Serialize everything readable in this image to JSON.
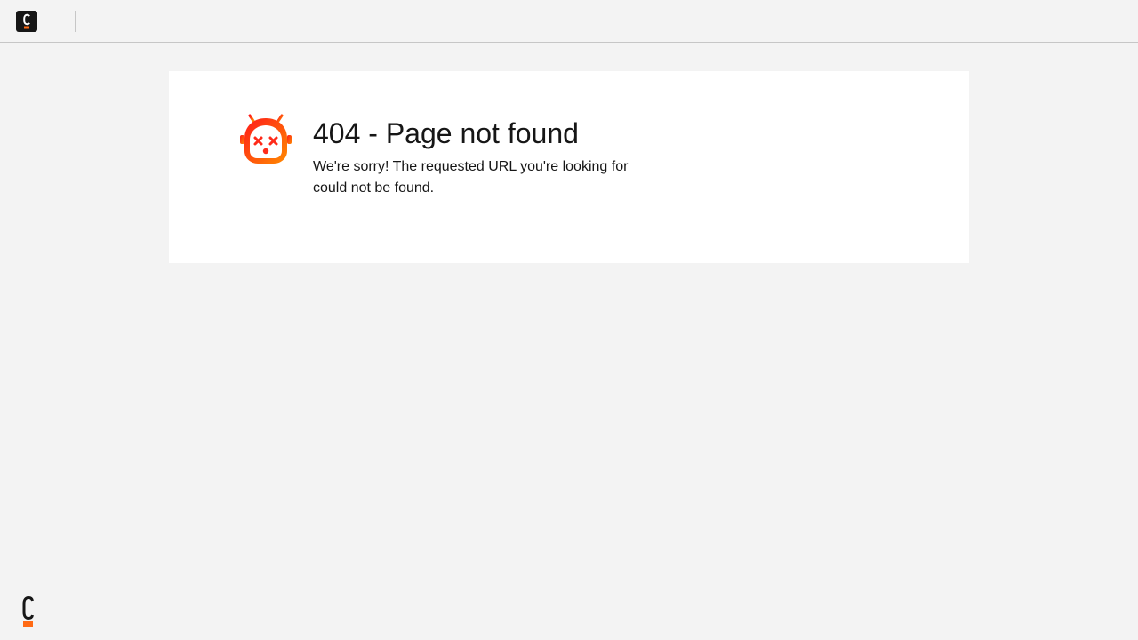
{
  "header": {
    "logo_icon": "brand-c-logo-icon"
  },
  "error": {
    "icon": "broken-robot-icon",
    "title": "404 - Page not found",
    "message": "We're sorry! The requested URL you're looking for could not be found."
  },
  "footer": {
    "logo_icon": "brand-c-logo-icon"
  },
  "colors": {
    "background": "#f3f3f3",
    "card": "#ffffff",
    "text": "#161616",
    "accent_orange": "#ff6a14",
    "accent_red": "#ff2b1a",
    "divider": "#c6c6c6"
  }
}
